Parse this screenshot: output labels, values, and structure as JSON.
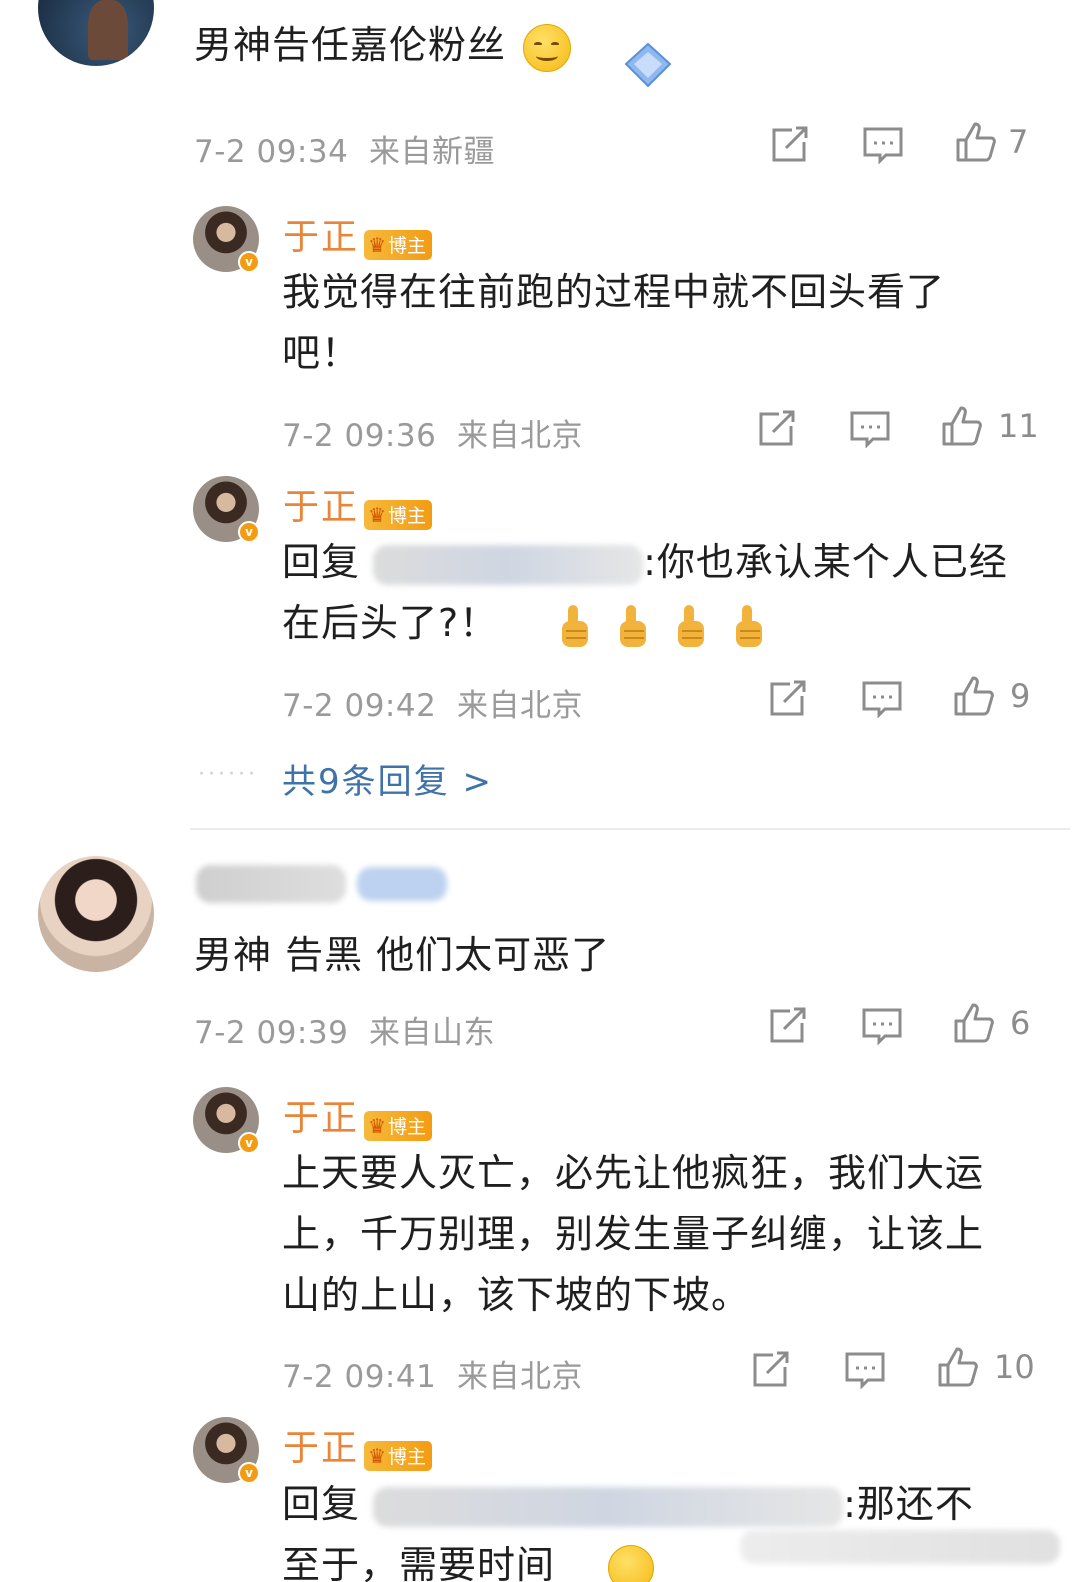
{
  "comments": [
    {
      "text": "男神告任嘉伦粉丝",
      "time": "7-2 09:34",
      "location": "来自新疆",
      "likes": "7",
      "replies": [
        {
          "author": "于正",
          "badge": "博主",
          "text_line1": "我觉得在往前跑的过程中就不回头看了",
          "text_line2": "吧！",
          "time": "7-2 09:36",
          "location": "来自北京",
          "likes": "11"
        },
        {
          "author": "于正",
          "badge": "博主",
          "reply_prefix": "回复",
          "text_line1_after": ":你也承认某个人已经",
          "text_line2": "在后头了?！",
          "time": "7-2 09:42",
          "location": "来自北京",
          "likes": "9"
        }
      ],
      "more_replies": "共9条回复 >",
      "dots": "······"
    },
    {
      "text": "男神 告黑 他们太可恶了",
      "time": "7-2 09:39",
      "location": "来自山东",
      "likes": "6",
      "replies": [
        {
          "author": "于正",
          "badge": "博主",
          "text_line1": "上天要人灭亡，必先让他疯狂，我们大运",
          "text_line2": "上，千万别理，别发生量子纠缠，让该上",
          "text_line3": "山的上山，该下坡的下坡。",
          "time": "7-2 09:41",
          "location": "来自北京",
          "likes": "10"
        },
        {
          "author": "于正",
          "badge": "博主",
          "reply_prefix": "回复",
          "text_line1_after": ":那还不",
          "text_line2": "至于，需要时间"
        }
      ]
    }
  ],
  "icons": {
    "share": "share-icon",
    "comment": "comment-icon",
    "like": "thumbs-up-icon"
  },
  "colors": {
    "author": "#e8853a",
    "link": "#3f72a8",
    "meta": "#9a9a9a",
    "badge": "#f39c12"
  }
}
